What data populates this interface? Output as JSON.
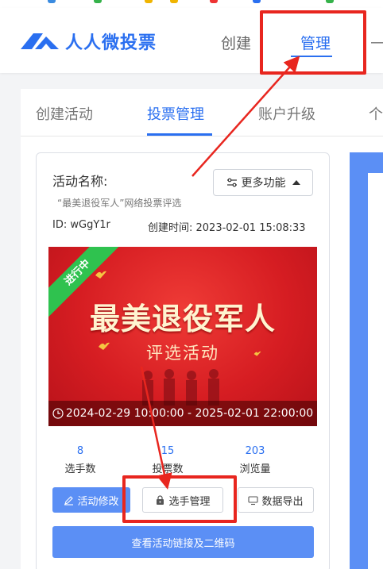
{
  "header": {
    "logo_text": "人人微投票",
    "nav": {
      "create": "创建",
      "manage": "管理"
    }
  },
  "tabs": {
    "create_activity": "创建活动",
    "vote_manage": "投票管理",
    "upgrade": "账户升级",
    "partial": "个"
  },
  "activity": {
    "name_label": "活动名称:",
    "name_value": "“最美退役军人”网络投票评选",
    "more_button": "更多功能",
    "id_text": "ID:  wGgY1r",
    "created_text": "创建时间:  2023-02-01 15:08:33",
    "banner": {
      "status_ribbon": "进行中",
      "title": "最美退役军人",
      "subtitle": "评选活动",
      "date_range": "2024-02-29 10:00:00 - 2025-02-01 22:00:00"
    },
    "stats": [
      {
        "value": "8",
        "label": "选手数"
      },
      {
        "value": "15",
        "label": "投票数"
      },
      {
        "value": "203",
        "label": "浏览量"
      }
    ],
    "buttons": {
      "edit": "活动修改",
      "players": "选手管理",
      "export": "数据导出",
      "link_qr": "查看活动链接及二维码"
    }
  },
  "colors": {
    "accent": "#2a6ff0",
    "button_blue": "#5b8ff5",
    "annotation_red": "#e8261f",
    "ribbon_green": "#2fc24f"
  }
}
